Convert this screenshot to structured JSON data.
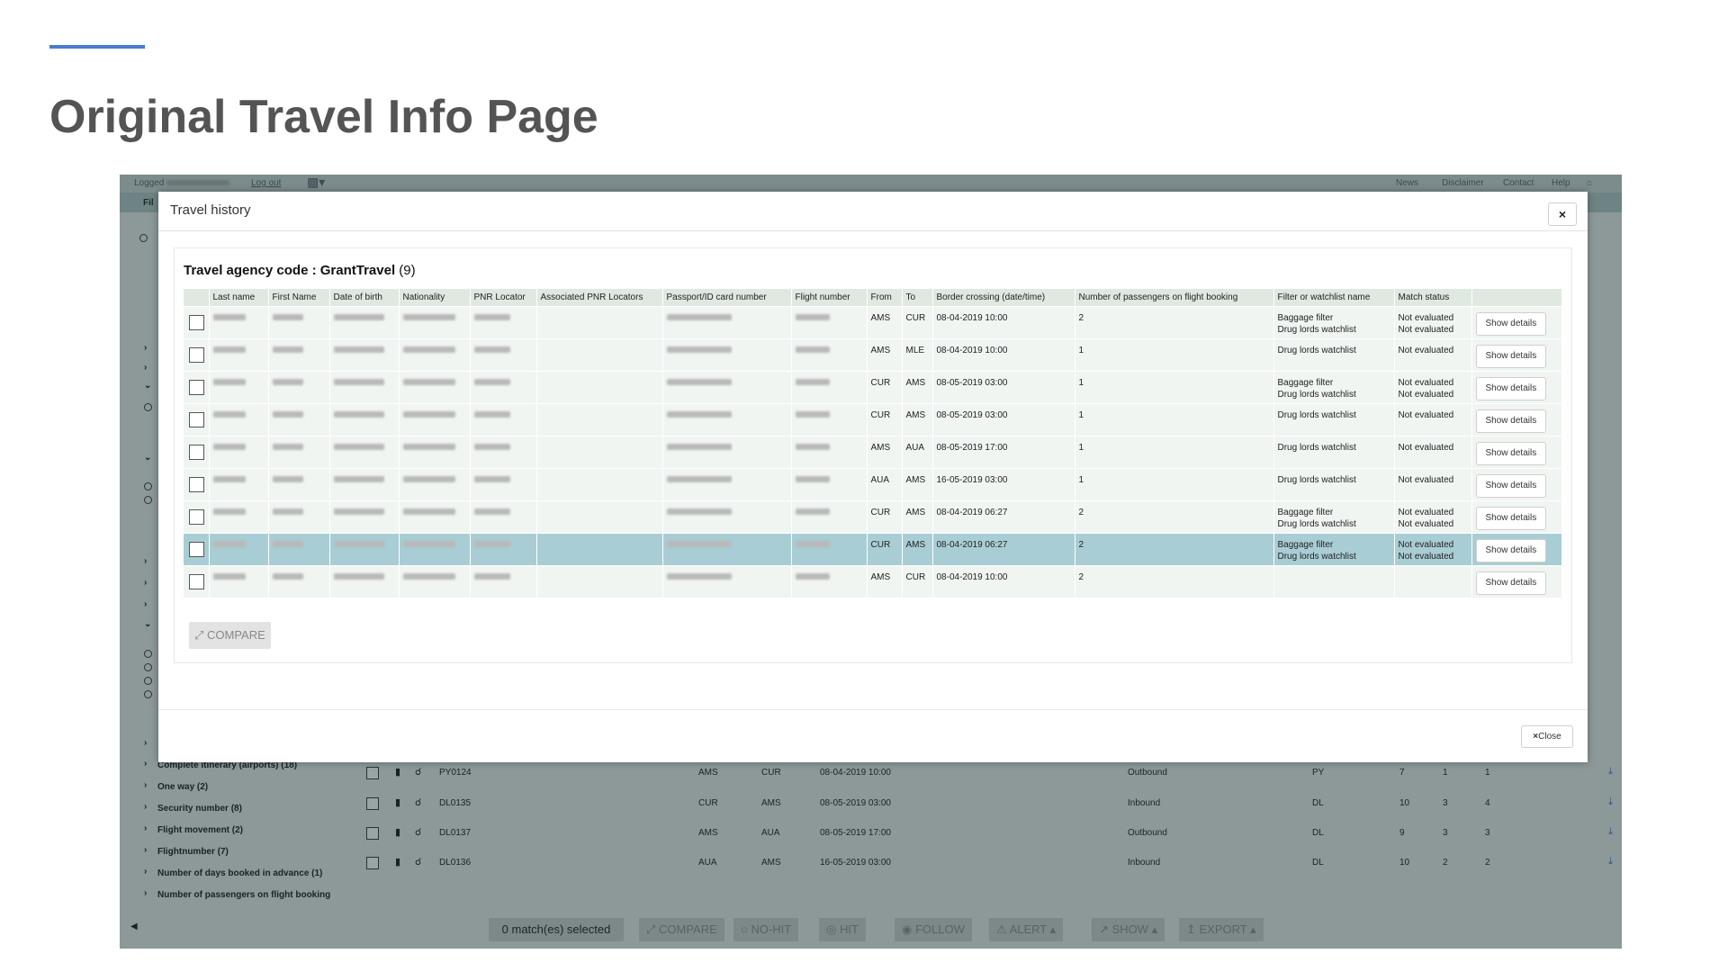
{
  "slide": {
    "title": "Original Travel Info Page",
    "accent_color": "#4a7bd0"
  },
  "app": {
    "topbar": {
      "logged_prefix": "Logged",
      "logout": "Log out",
      "links": [
        "News",
        "Disclaimer",
        "Contact",
        "Help"
      ]
    },
    "menubar_label": "Fil",
    "sidebar_items": [
      "Complete itinerary (airports) (18)",
      "One way (2)",
      "Security number (8)",
      "Flight movement (2)",
      "Flightnumber (7)",
      "Number of days booked in advance (1)",
      "Number of passengers on flight booking"
    ],
    "rows": [
      {
        "flight": "PY0124",
        "from": "AMS",
        "to": "CUR",
        "date": "08-04-2019 10:00",
        "direction": "Outbound",
        "code": "PY",
        "a": "7",
        "b": "1",
        "c": "1"
      },
      {
        "flight": "DL0135",
        "from": "CUR",
        "to": "AMS",
        "date": "08-05-2019 03:00",
        "direction": "Inbound",
        "code": "DL",
        "a": "10",
        "b": "3",
        "c": "4"
      },
      {
        "flight": "DL0137",
        "from": "AMS",
        "to": "AUA",
        "date": "08-05-2019 17:00",
        "direction": "Outbound",
        "code": "DL",
        "a": "9",
        "b": "3",
        "c": "3"
      },
      {
        "flight": "DL0136",
        "from": "AUA",
        "to": "AMS",
        "date": "16-05-2019 03:00",
        "direction": "Inbound",
        "code": "DL",
        "a": "10",
        "b": "2",
        "c": "2"
      }
    ],
    "bottombar": {
      "selected": "0 match(es) selected",
      "compare": "COMPARE",
      "nohit": "NO-HIT",
      "hit": "HIT",
      "follow": "FOLLOW",
      "alert": "ALERT",
      "show": "SHOW",
      "export": "EXPORT"
    }
  },
  "modal": {
    "title": "Travel history",
    "close_x": "×",
    "agency_label": "Travel agency code : ",
    "agency_code": "GrantTravel",
    "agency_count": "(9)",
    "columns": [
      "",
      "Last name",
      "First Name",
      "Date of birth",
      "Nationality",
      "PNR Locator",
      "Associated PNR Locators",
      "Passport/ID card number",
      "Flight number",
      "From",
      "To",
      "Border crossing (date/time)",
      "Number of passengers on flight booking",
      "Filter or watchlist name",
      "Match status",
      ""
    ],
    "show_details_label": "Show details",
    "rows": [
      {
        "from": "AMS",
        "to": "CUR",
        "border": "08-04-2019 10:00",
        "pax": "2",
        "filters": [
          "Baggage filter",
          "Drug lords watchlist"
        ],
        "status": [
          "Not evaluated",
          "Not evaluated"
        ],
        "selected": false
      },
      {
        "from": "AMS",
        "to": "MLE",
        "border": "08-04-2019 10:00",
        "pax": "1",
        "filters": [
          "Drug lords watchlist"
        ],
        "status": [
          "Not evaluated"
        ],
        "selected": false
      },
      {
        "from": "CUR",
        "to": "AMS",
        "border": "08-05-2019 03:00",
        "pax": "1",
        "filters": [
          "Baggage filter",
          "Drug lords watchlist"
        ],
        "status": [
          "Not evaluated",
          "Not evaluated"
        ],
        "selected": false
      },
      {
        "from": "CUR",
        "to": "AMS",
        "border": "08-05-2019 03:00",
        "pax": "1",
        "filters": [
          "Drug lords watchlist"
        ],
        "status": [
          "Not evaluated"
        ],
        "selected": false
      },
      {
        "from": "AMS",
        "to": "AUA",
        "border": "08-05-2019 17:00",
        "pax": "1",
        "filters": [
          "Drug lords watchlist"
        ],
        "status": [
          "Not evaluated"
        ],
        "selected": false
      },
      {
        "from": "AUA",
        "to": "AMS",
        "border": "16-05-2019 03:00",
        "pax": "1",
        "filters": [
          "Drug lords watchlist"
        ],
        "status": [
          "Not evaluated"
        ],
        "selected": false
      },
      {
        "from": "CUR",
        "to": "AMS",
        "border": "08-04-2019 06:27",
        "pax": "2",
        "filters": [
          "Baggage filter",
          "Drug lords watchlist"
        ],
        "status": [
          "Not evaluated",
          "Not evaluated"
        ],
        "selected": false
      },
      {
        "from": "CUR",
        "to": "AMS",
        "border": "08-04-2019 06:27",
        "pax": "2",
        "filters": [
          "Baggage filter",
          "Drug lords watchlist"
        ],
        "status": [
          "Not evaluated",
          "Not evaluated"
        ],
        "selected": true
      },
      {
        "from": "AMS",
        "to": "CUR",
        "border": "08-04-2019 10:00",
        "pax": "2",
        "filters": [],
        "status": [],
        "selected": false
      }
    ],
    "compare_label": "COMPARE",
    "close_label": "Close",
    "close_icon": "×"
  }
}
